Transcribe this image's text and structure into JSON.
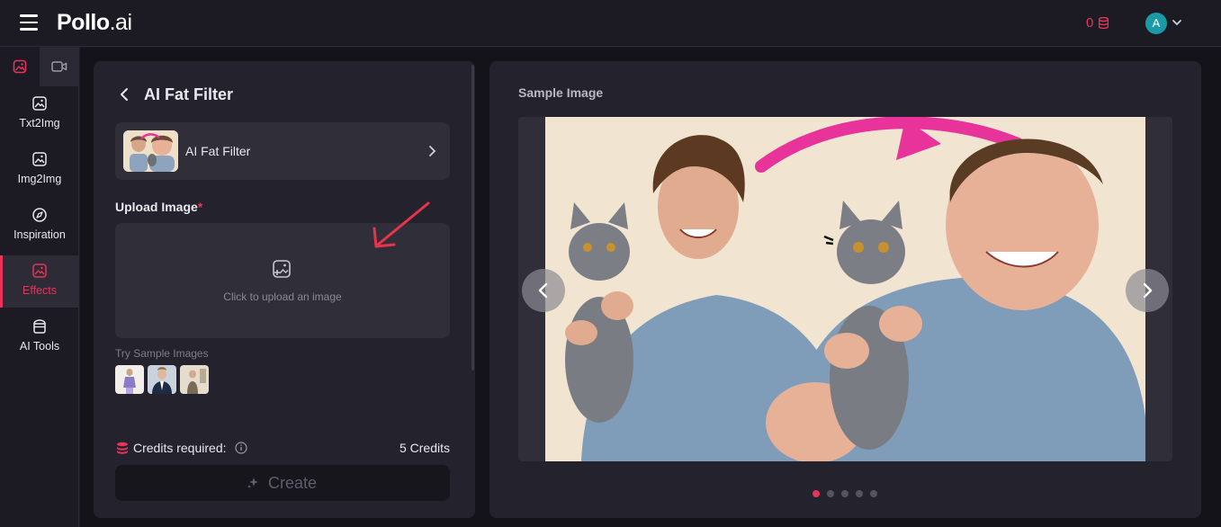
{
  "header": {
    "logo_main": "Pollo",
    "logo_suffix": ".ai",
    "credits_count": "0",
    "avatar_initial": "A"
  },
  "sidebar": {
    "items": [
      {
        "label": "Txt2Img",
        "icon": "text-to-image-icon"
      },
      {
        "label": "Img2Img",
        "icon": "image-to-image-icon"
      },
      {
        "label": "Inspiration",
        "icon": "compass-icon"
      },
      {
        "label": "Effects",
        "icon": "effects-icon",
        "active": true
      },
      {
        "label": "AI Tools",
        "icon": "toolbox-icon"
      }
    ]
  },
  "panel": {
    "title": "AI Fat Filter",
    "effect_name": "AI Fat Filter",
    "upload_label": "Upload Image",
    "required_mark": "*",
    "upload_hint": "Click to upload an image",
    "sample_label": "Try Sample Images",
    "credits_label": "Credits required:",
    "credits_value": "5 Credits",
    "create_label": "Create"
  },
  "preview": {
    "title": "Sample Image",
    "slide_count": 5,
    "active_slide": 0
  },
  "colors": {
    "accent": "#e8345a",
    "panel_bg": "#24232d",
    "page_bg": "#14131a"
  }
}
